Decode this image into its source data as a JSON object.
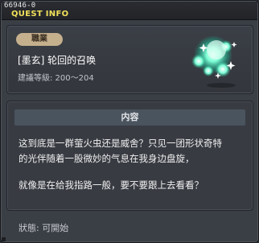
{
  "window": {
    "id": "66946-0",
    "title": "QUEST INFO"
  },
  "quest": {
    "job_label": "職業",
    "name": "[墨玄] 轮回的召唤",
    "level_requirement": "建議等級: 200～204",
    "icon": "green-firefly-sparkles-icon"
  },
  "content": {
    "header": "内容",
    "paragraphs": [
      "这到底是一群萤火虫还是威舍？只见一团形状奇特",
      "的光伴随着一股微妙的气息在我身边盘旋，",
      "就像是在给我指路一般，要不要跟上去看看？"
    ]
  },
  "status": {
    "label": "狀態: 可開始"
  },
  "colors": {
    "title": "#f1e15a",
    "badge": "#c5b08d",
    "glow": "#5fffd0"
  }
}
